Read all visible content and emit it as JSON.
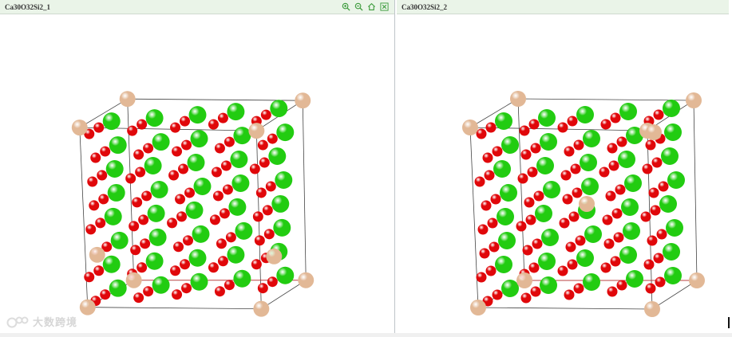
{
  "panels": [
    {
      "title": "Ca30O32Si2_1",
      "toolbar": [
        {
          "icon": "zoom-in-icon"
        },
        {
          "icon": "zoom-out-icon"
        },
        {
          "icon": "home-icon"
        },
        {
          "icon": "close-icon"
        }
      ]
    },
    {
      "title": "Ca30O32Si2_2"
    }
  ],
  "colors": {
    "calcium": "#22cc11",
    "oxygen": "#e0070a",
    "silicon": "#e2b896",
    "cell_edge": "#444444",
    "axis_red": "#d03030",
    "header_bg": "#eaf4e8",
    "toolbar_green": "#3a9a3a"
  },
  "watermark": {
    "text": "大数跨境"
  }
}
